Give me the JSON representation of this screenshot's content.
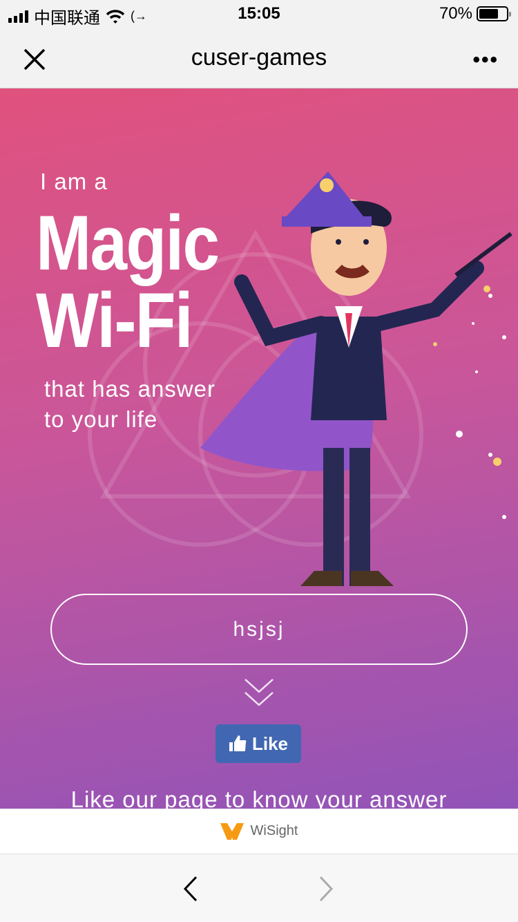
{
  "status_bar": {
    "carrier": "中国联通",
    "time": "15:05",
    "battery": "70%",
    "battery_level": 0.7
  },
  "navbar": {
    "title": "cuser-games",
    "close_icon": "close-icon",
    "more_icon": "more-dots-icon"
  },
  "hero": {
    "line1": "I am a",
    "headline1": "Magic",
    "headline2": "Wi-Fi",
    "subline1": "that has answer",
    "subline2": "to your life",
    "answer_value": "hsjsj",
    "like_button": "Like",
    "like_prompt": "Like our page to know your answer"
  },
  "brand": {
    "name": "WiSight"
  },
  "colors": {
    "gradient_top": "#e0527e",
    "gradient_bottom": "#9154b8",
    "like_blue": "#4267b2"
  }
}
